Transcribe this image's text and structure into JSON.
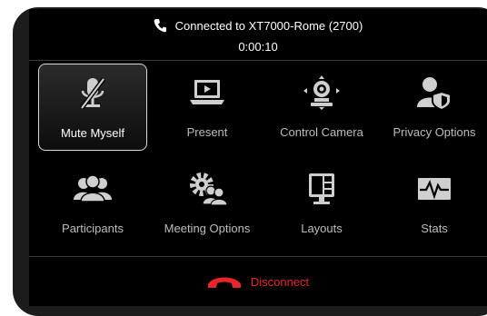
{
  "header": {
    "connection_text": "Connected to XT7000-Rome  (2700)",
    "call_timer": "0:00:10"
  },
  "actions": [
    {
      "label": "Mute Myself",
      "icon": "microphone-muted-icon",
      "selected": true
    },
    {
      "label": "Present",
      "icon": "laptop-present-icon",
      "selected": false
    },
    {
      "label": "Control Camera",
      "icon": "camera-control-icon",
      "selected": false
    },
    {
      "label": "Privacy Options",
      "icon": "privacy-shield-icon",
      "selected": false
    },
    {
      "label": "Participants",
      "icon": "participants-icon",
      "selected": false
    },
    {
      "label": "Meeting Options",
      "icon": "meeting-options-icon",
      "selected": false
    },
    {
      "label": "Layouts",
      "icon": "layouts-icon",
      "selected": false
    },
    {
      "label": "Stats",
      "icon": "stats-icon",
      "selected": false
    }
  ],
  "footer": {
    "disconnect_label": "Disconnect",
    "disconnect_color": "#e8242b"
  }
}
